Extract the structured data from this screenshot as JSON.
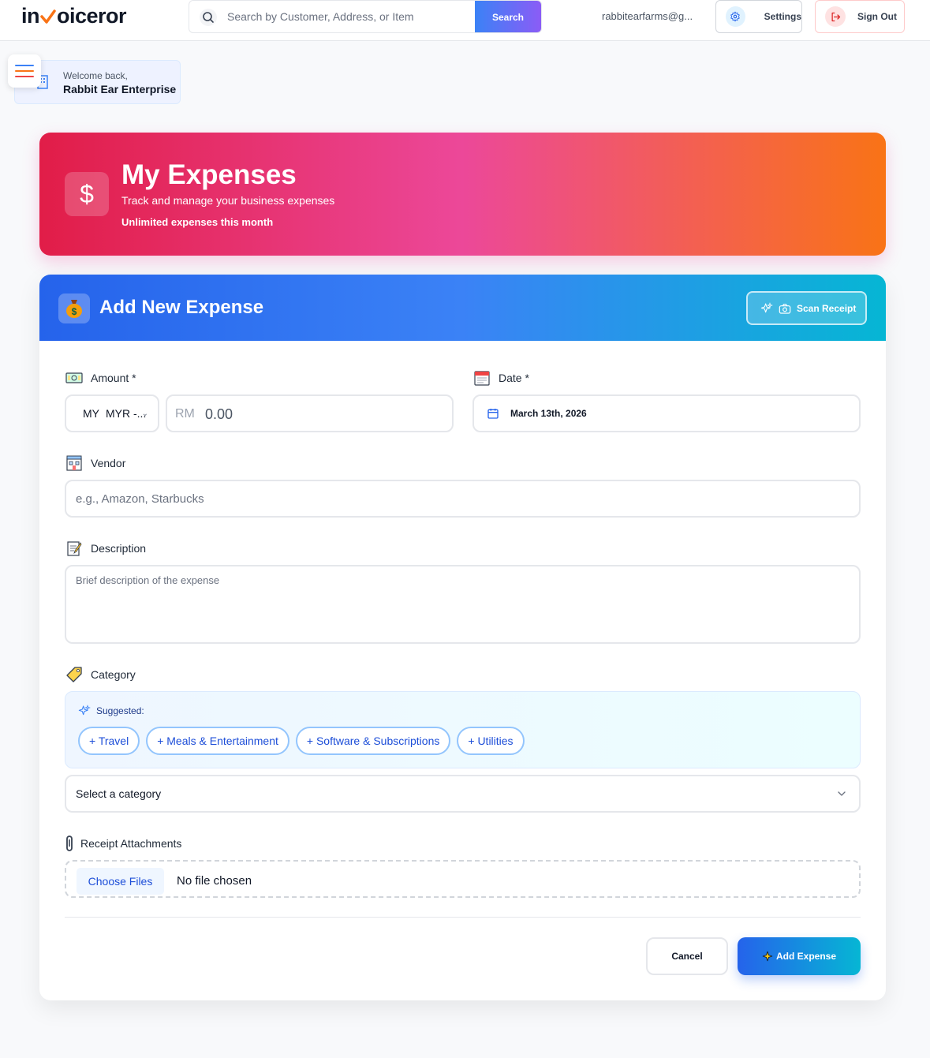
{
  "header": {
    "logo_prefix": "in",
    "logo_suffix": "oiceror",
    "search": {
      "placeholder": "Search by Customer, Address, or Item",
      "button_label": "Search"
    },
    "user_email": "rabbitearfarms@g...",
    "settings_label": "Settings",
    "signout_label": "Sign Out"
  },
  "welcome": {
    "greeting": "Welcome back,",
    "name": "Rabbit Ear Enterprise"
  },
  "hero": {
    "icon": "$",
    "title": "My Expenses",
    "subtitle": "Track and manage your business expenses",
    "note": "Unlimited expenses this month"
  },
  "form": {
    "title": "Add New Expense",
    "scan_label": "Scan Receipt",
    "amount": {
      "label": "Amount *",
      "currency_flag": "MY",
      "currency_code": "MYR -...",
      "symbol": "RM",
      "placeholder": "0.00"
    },
    "date": {
      "label": "Date *",
      "value": "March 13th, 2026"
    },
    "vendor": {
      "label": "Vendor",
      "placeholder": "e.g., Amazon, Starbucks"
    },
    "description": {
      "label": "Description",
      "placeholder": "Brief description of the expense"
    },
    "category": {
      "label": "Category",
      "suggested_label": "Suggested:",
      "suggestions": [
        "+ Travel",
        "+ Meals & Entertainment",
        "+ Software & Subscriptions",
        "+ Utilities"
      ],
      "select_value": "Select a category"
    },
    "attachments": {
      "label": "Receipt Attachments",
      "choose_label": "Choose Files",
      "status": "No file chosen"
    },
    "cancel_label": "Cancel",
    "submit_label": "Add Expense"
  },
  "colors": {
    "hero_gradient_start": "#e11d48",
    "hero_gradient_mid": "#ec4899",
    "hero_gradient_end": "#f97316",
    "form_header_start": "#2563eb",
    "form_header_end": "#06b6d4",
    "accent_blue": "#1d4ed8"
  },
  "icons": {
    "search": "search-icon",
    "settings": "gear-icon",
    "signout": "sign-out-icon",
    "menu": "hamburger-icon",
    "building": "building-icon",
    "hero": "dollar-icon",
    "form": "money-bag-icon",
    "scan_sparkle": "sparkle-icon",
    "scan_camera": "camera-icon",
    "amount": "money-icon",
    "date": "calendar-icon",
    "vendor": "store-icon",
    "description": "memo-icon",
    "category": "tag-icon",
    "attachments": "paperclip-icon"
  }
}
